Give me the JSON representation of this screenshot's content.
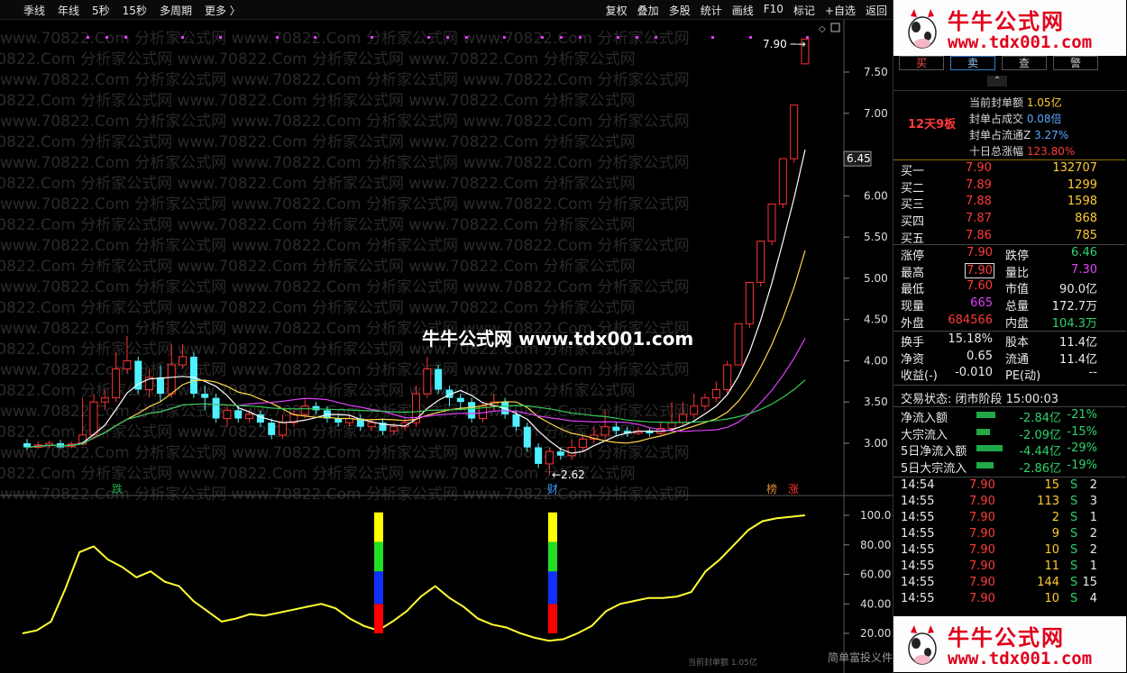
{
  "toolbar": {
    "left": [
      "季线",
      "年线",
      "5秒",
      "15秒",
      "多周期",
      "更多 〉"
    ],
    "right": [
      "复权",
      "叠加",
      "多股",
      "统计",
      "画线",
      "F10",
      "标记",
      "+自选",
      "返回"
    ]
  },
  "chart": {
    "price_ticks": [
      "7.50",
      "7.00",
      "6.45",
      "6.00",
      "5.50",
      "5.00",
      "4.50",
      "4.00",
      "3.50",
      "3.00"
    ],
    "osc_ticks": [
      "100.0",
      "80.00",
      "60.00",
      "40.00",
      "20.00"
    ],
    "current_price_tag": "6.45",
    "high_label": "7.90",
    "low_label": "2.62",
    "markers": [
      "跌",
      "财",
      "榜",
      "涨"
    ],
    "watermark": "www.70822.Com 分析家公式网",
    "center_logo": "牛牛公式网 www.tdx001.com",
    "bottom_hint": "当前封单额 1.05亿",
    "bottom_right_hint": "简单富投义件"
  },
  "brand": {
    "title": "牛牛公式网",
    "url": "www.tdx001.com"
  },
  "trade_tabs": [
    "买",
    "卖",
    "查",
    "警"
  ],
  "seal": {
    "days_label": "12天9板",
    "rows": [
      {
        "label": "当前封单额",
        "value": "1.05亿"
      },
      {
        "label": "封单占成交",
        "value": "0.08倍"
      },
      {
        "label": "封单占流通Z",
        "value": "3.27%"
      },
      {
        "label": "十日总涨幅",
        "value": "123.80%"
      }
    ]
  },
  "bids": [
    {
      "label": "买一",
      "price": "7.90",
      "vol": "132707"
    },
    {
      "label": "买二",
      "price": "7.89",
      "vol": "1299"
    },
    {
      "label": "买三",
      "price": "7.88",
      "vol": "1598"
    },
    {
      "label": "买四",
      "price": "7.87",
      "vol": "868"
    },
    {
      "label": "买五",
      "price": "7.86",
      "vol": "785"
    }
  ],
  "stats1": [
    {
      "l1": "涨停",
      "v1": "7.90",
      "l2": "跌停",
      "v2": "6.46"
    },
    {
      "l1": "最高",
      "v1": "7.90",
      "l2": "量比",
      "v2": "7.30"
    },
    {
      "l1": "最低",
      "v1": "7.60",
      "l2": "市值",
      "v2": "90.0亿"
    },
    {
      "l1": "现量",
      "v1": "665",
      "l2": "总量",
      "v2": "172.7万"
    },
    {
      "l1": "外盘",
      "v1": "684566",
      "l2": "内盘",
      "v2": "104.3万"
    }
  ],
  "stats2": [
    {
      "l1": "换手",
      "v1": "15.18%",
      "l2": "股本",
      "v2": "11.4亿"
    },
    {
      "l1": "净资",
      "v1": "0.65",
      "l2": "流通",
      "v2": "11.4亿"
    },
    {
      "l1": "收益(-)",
      "v1": "-0.010",
      "l2": "PE(动)",
      "v2": "--"
    }
  ],
  "status": {
    "label": "交易状态:",
    "value": "闭市阶段 15:00:03"
  },
  "flows": [
    {
      "label": "净流入额",
      "value": "-2.84亿",
      "pct": "-21%",
      "fill": 0.21
    },
    {
      "label": "大宗流入",
      "value": "-2.09亿",
      "pct": "-15%",
      "fill": 0.15
    },
    {
      "label": "5日净流入额",
      "value": "-4.44亿",
      "pct": "-29%",
      "fill": 0.29
    },
    {
      "label": "5日大宗流入",
      "value": "-2.86亿",
      "pct": "-19%",
      "fill": 0.19
    }
  ],
  "ticks": [
    {
      "time": "14:54",
      "price": "7.90",
      "vol": "15",
      "side": "S",
      "n": "2"
    },
    {
      "time": "14:55",
      "price": "7.90",
      "vol": "113",
      "side": "S",
      "n": "3"
    },
    {
      "time": "14:55",
      "price": "7.90",
      "vol": "2",
      "side": "S",
      "n": "1"
    },
    {
      "time": "14:55",
      "price": "7.90",
      "vol": "9",
      "side": "S",
      "n": "2"
    },
    {
      "time": "14:55",
      "price": "7.90",
      "vol": "10",
      "side": "S",
      "n": "2"
    },
    {
      "time": "14:55",
      "price": "7.90",
      "vol": "11",
      "side": "S",
      "n": "1"
    },
    {
      "time": "14:55",
      "price": "7.90",
      "vol": "144",
      "side": "S",
      "n": "15"
    },
    {
      "time": "14:55",
      "price": "7.90",
      "vol": "10",
      "side": "S",
      "n": "4"
    }
  ]
}
